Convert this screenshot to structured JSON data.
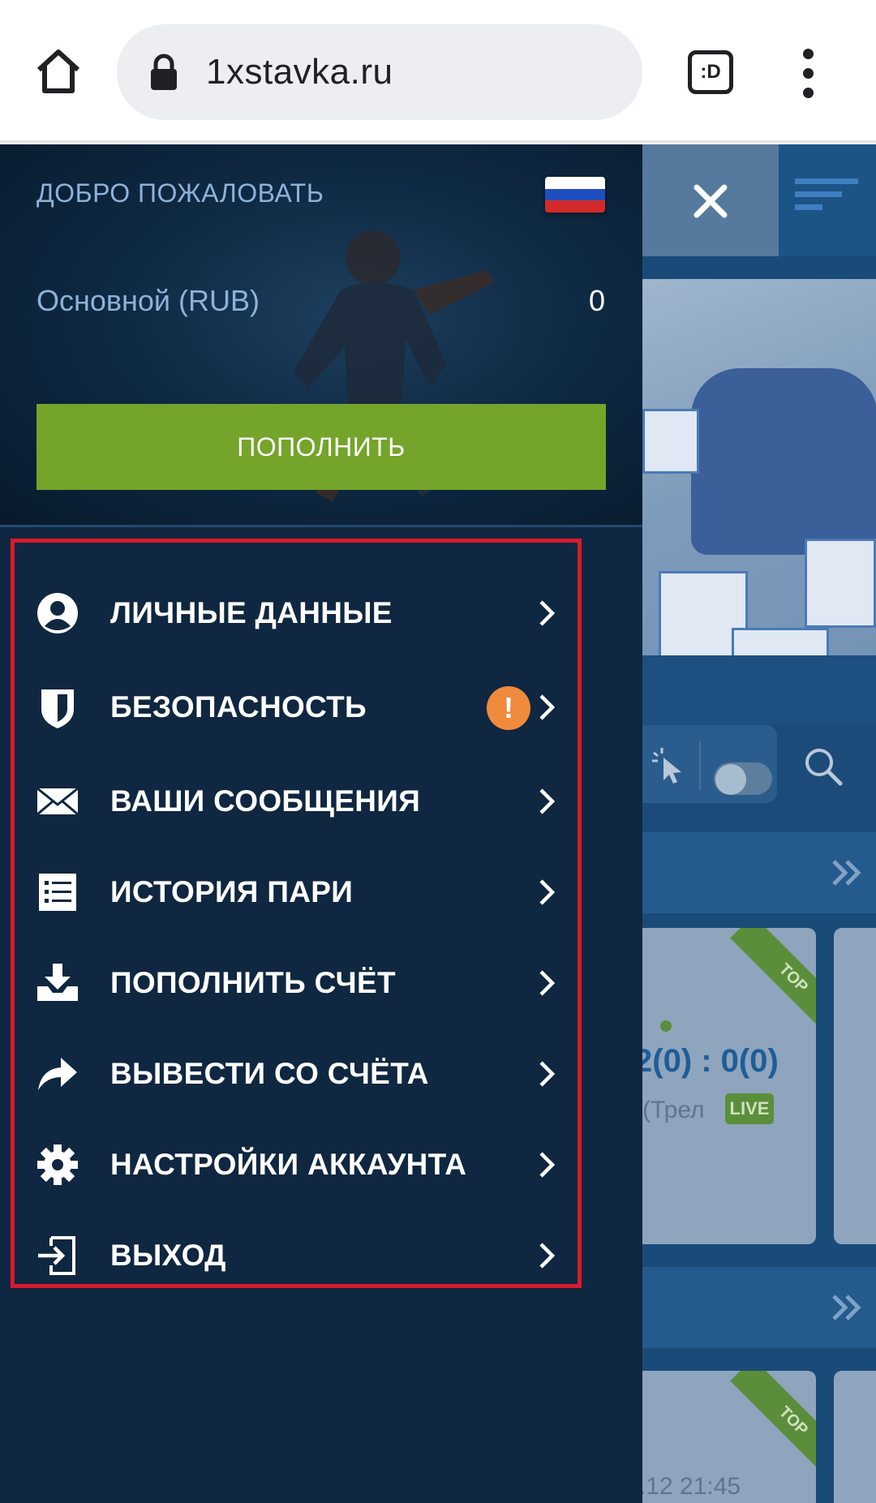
{
  "browser": {
    "url": "1xstavka.ru",
    "tabs_label": ":D"
  },
  "drawer": {
    "welcome": "ДОБРО ПОЖАЛОВАТЬ",
    "account_name": "Основной (RUB)",
    "account_balance": "0",
    "topup_button": "ПОПОЛНИТЬ",
    "menu": [
      {
        "label": "ЛИЧНЫЕ ДАННЫЕ",
        "icon": "user-icon"
      },
      {
        "label": "БЕЗОПАСНОСТЬ",
        "icon": "shield-icon",
        "badge": "!"
      },
      {
        "label": "ВАШИ СООБЩЕНИЯ",
        "icon": "envelope-icon"
      },
      {
        "label": "ИСТОРИЯ ПАРИ",
        "icon": "list-icon"
      },
      {
        "label": "ПОПОЛНИТЬ СЧЁТ",
        "icon": "download-icon"
      },
      {
        "label": "ВЫВЕСТИ СО СЧЁТА",
        "icon": "share-arrow-icon"
      },
      {
        "label": "НАСТРОЙКИ АККАУНТА",
        "icon": "gear-icon"
      },
      {
        "label": "ВЫХОД",
        "icon": "logout-icon"
      }
    ]
  },
  "background_site": {
    "ribbon": "TOP",
    "score": "2(0)  :  0(0)",
    "team_fragment": "(Трел",
    "live": "LIVE",
    "date_fragment": ".12 21:45"
  },
  "colors": {
    "accent_green": "#74a42a",
    "warning_orange": "#f08a3c",
    "highlight_red": "#d81b2c",
    "drawer_bg": "#0f2740"
  }
}
